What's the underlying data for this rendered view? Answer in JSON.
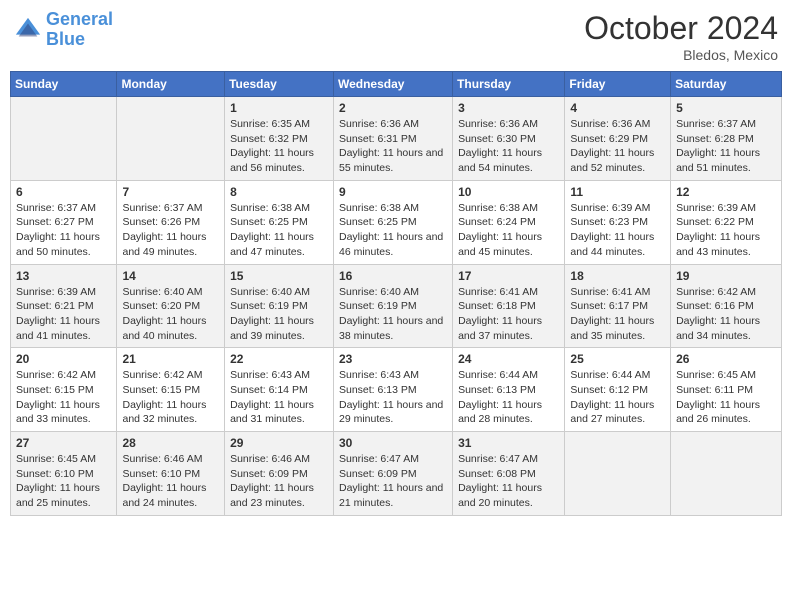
{
  "header": {
    "logo_line1": "General",
    "logo_line2": "Blue",
    "month": "October 2024",
    "location": "Bledos, Mexico"
  },
  "days_of_week": [
    "Sunday",
    "Monday",
    "Tuesday",
    "Wednesday",
    "Thursday",
    "Friday",
    "Saturday"
  ],
  "weeks": [
    [
      {
        "day": "",
        "sunrise": "",
        "sunset": "",
        "daylight": ""
      },
      {
        "day": "",
        "sunrise": "",
        "sunset": "",
        "daylight": ""
      },
      {
        "day": "1",
        "sunrise": "Sunrise: 6:35 AM",
        "sunset": "Sunset: 6:32 PM",
        "daylight": "Daylight: 11 hours and 56 minutes."
      },
      {
        "day": "2",
        "sunrise": "Sunrise: 6:36 AM",
        "sunset": "Sunset: 6:31 PM",
        "daylight": "Daylight: 11 hours and 55 minutes."
      },
      {
        "day": "3",
        "sunrise": "Sunrise: 6:36 AM",
        "sunset": "Sunset: 6:30 PM",
        "daylight": "Daylight: 11 hours and 54 minutes."
      },
      {
        "day": "4",
        "sunrise": "Sunrise: 6:36 AM",
        "sunset": "Sunset: 6:29 PM",
        "daylight": "Daylight: 11 hours and 52 minutes."
      },
      {
        "day": "5",
        "sunrise": "Sunrise: 6:37 AM",
        "sunset": "Sunset: 6:28 PM",
        "daylight": "Daylight: 11 hours and 51 minutes."
      }
    ],
    [
      {
        "day": "6",
        "sunrise": "Sunrise: 6:37 AM",
        "sunset": "Sunset: 6:27 PM",
        "daylight": "Daylight: 11 hours and 50 minutes."
      },
      {
        "day": "7",
        "sunrise": "Sunrise: 6:37 AM",
        "sunset": "Sunset: 6:26 PM",
        "daylight": "Daylight: 11 hours and 49 minutes."
      },
      {
        "day": "8",
        "sunrise": "Sunrise: 6:38 AM",
        "sunset": "Sunset: 6:25 PM",
        "daylight": "Daylight: 11 hours and 47 minutes."
      },
      {
        "day": "9",
        "sunrise": "Sunrise: 6:38 AM",
        "sunset": "Sunset: 6:25 PM",
        "daylight": "Daylight: 11 hours and 46 minutes."
      },
      {
        "day": "10",
        "sunrise": "Sunrise: 6:38 AM",
        "sunset": "Sunset: 6:24 PM",
        "daylight": "Daylight: 11 hours and 45 minutes."
      },
      {
        "day": "11",
        "sunrise": "Sunrise: 6:39 AM",
        "sunset": "Sunset: 6:23 PM",
        "daylight": "Daylight: 11 hours and 44 minutes."
      },
      {
        "day": "12",
        "sunrise": "Sunrise: 6:39 AM",
        "sunset": "Sunset: 6:22 PM",
        "daylight": "Daylight: 11 hours and 43 minutes."
      }
    ],
    [
      {
        "day": "13",
        "sunrise": "Sunrise: 6:39 AM",
        "sunset": "Sunset: 6:21 PM",
        "daylight": "Daylight: 11 hours and 41 minutes."
      },
      {
        "day": "14",
        "sunrise": "Sunrise: 6:40 AM",
        "sunset": "Sunset: 6:20 PM",
        "daylight": "Daylight: 11 hours and 40 minutes."
      },
      {
        "day": "15",
        "sunrise": "Sunrise: 6:40 AM",
        "sunset": "Sunset: 6:19 PM",
        "daylight": "Daylight: 11 hours and 39 minutes."
      },
      {
        "day": "16",
        "sunrise": "Sunrise: 6:40 AM",
        "sunset": "Sunset: 6:19 PM",
        "daylight": "Daylight: 11 hours and 38 minutes."
      },
      {
        "day": "17",
        "sunrise": "Sunrise: 6:41 AM",
        "sunset": "Sunset: 6:18 PM",
        "daylight": "Daylight: 11 hours and 37 minutes."
      },
      {
        "day": "18",
        "sunrise": "Sunrise: 6:41 AM",
        "sunset": "Sunset: 6:17 PM",
        "daylight": "Daylight: 11 hours and 35 minutes."
      },
      {
        "day": "19",
        "sunrise": "Sunrise: 6:42 AM",
        "sunset": "Sunset: 6:16 PM",
        "daylight": "Daylight: 11 hours and 34 minutes."
      }
    ],
    [
      {
        "day": "20",
        "sunrise": "Sunrise: 6:42 AM",
        "sunset": "Sunset: 6:15 PM",
        "daylight": "Daylight: 11 hours and 33 minutes."
      },
      {
        "day": "21",
        "sunrise": "Sunrise: 6:42 AM",
        "sunset": "Sunset: 6:15 PM",
        "daylight": "Daylight: 11 hours and 32 minutes."
      },
      {
        "day": "22",
        "sunrise": "Sunrise: 6:43 AM",
        "sunset": "Sunset: 6:14 PM",
        "daylight": "Daylight: 11 hours and 31 minutes."
      },
      {
        "day": "23",
        "sunrise": "Sunrise: 6:43 AM",
        "sunset": "Sunset: 6:13 PM",
        "daylight": "Daylight: 11 hours and 29 minutes."
      },
      {
        "day": "24",
        "sunrise": "Sunrise: 6:44 AM",
        "sunset": "Sunset: 6:13 PM",
        "daylight": "Daylight: 11 hours and 28 minutes."
      },
      {
        "day": "25",
        "sunrise": "Sunrise: 6:44 AM",
        "sunset": "Sunset: 6:12 PM",
        "daylight": "Daylight: 11 hours and 27 minutes."
      },
      {
        "day": "26",
        "sunrise": "Sunrise: 6:45 AM",
        "sunset": "Sunset: 6:11 PM",
        "daylight": "Daylight: 11 hours and 26 minutes."
      }
    ],
    [
      {
        "day": "27",
        "sunrise": "Sunrise: 6:45 AM",
        "sunset": "Sunset: 6:10 PM",
        "daylight": "Daylight: 11 hours and 25 minutes."
      },
      {
        "day": "28",
        "sunrise": "Sunrise: 6:46 AM",
        "sunset": "Sunset: 6:10 PM",
        "daylight": "Daylight: 11 hours and 24 minutes."
      },
      {
        "day": "29",
        "sunrise": "Sunrise: 6:46 AM",
        "sunset": "Sunset: 6:09 PM",
        "daylight": "Daylight: 11 hours and 23 minutes."
      },
      {
        "day": "30",
        "sunrise": "Sunrise: 6:47 AM",
        "sunset": "Sunset: 6:09 PM",
        "daylight": "Daylight: 11 hours and 21 minutes."
      },
      {
        "day": "31",
        "sunrise": "Sunrise: 6:47 AM",
        "sunset": "Sunset: 6:08 PM",
        "daylight": "Daylight: 11 hours and 20 minutes."
      },
      {
        "day": "",
        "sunrise": "",
        "sunset": "",
        "daylight": ""
      },
      {
        "day": "",
        "sunrise": "",
        "sunset": "",
        "daylight": ""
      }
    ]
  ]
}
